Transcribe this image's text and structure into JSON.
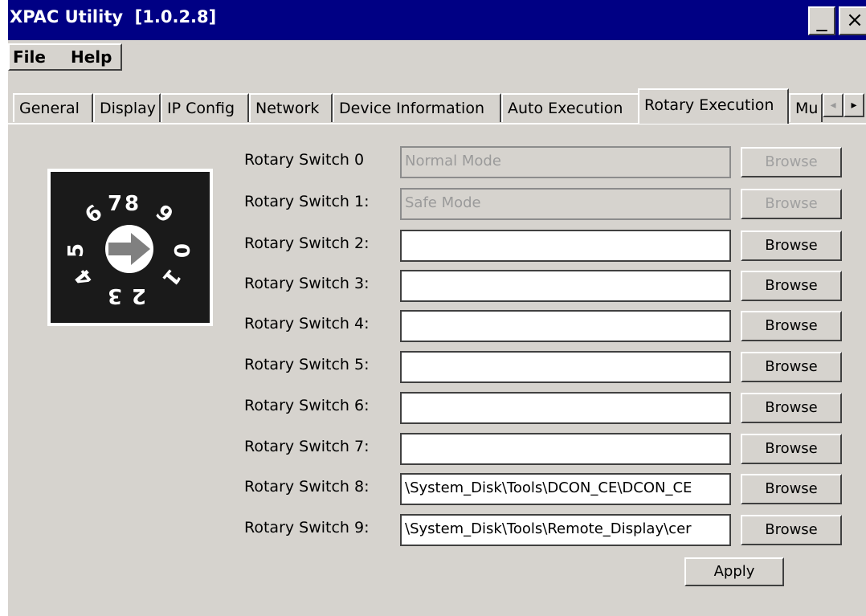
{
  "window": {
    "title": "XPAC Utility  [1.0.2.8]",
    "minimize_glyph": "_",
    "close_glyph": "×"
  },
  "menu": {
    "items": [
      "File",
      "Help"
    ]
  },
  "tabs": {
    "items": [
      "General",
      "Display",
      "IP Config",
      "Network",
      "Device Information",
      "Auto Execution",
      "Rotary Execution",
      "Mu"
    ],
    "active": "Rotary Execution",
    "scroll_left": "◂",
    "scroll_right": "▸"
  },
  "rotary_switch": {
    "icon": "rotary-switch-dial-icon",
    "digits": [
      "0",
      "1",
      "2",
      "3",
      "4",
      "5",
      "6",
      "7",
      "8",
      "9"
    ]
  },
  "rows": [
    {
      "label": "Rotary Switch 0",
      "value": "Normal Mode",
      "enabled": false,
      "button": "Browse"
    },
    {
      "label": "Rotary Switch 1:",
      "value": "Safe Mode",
      "enabled": false,
      "button": "Browse"
    },
    {
      "label": "Rotary Switch 2:",
      "value": "",
      "enabled": true,
      "button": "Browse"
    },
    {
      "label": "Rotary Switch 3:",
      "value": "",
      "enabled": true,
      "button": "Browse"
    },
    {
      "label": "Rotary Switch 4:",
      "value": "",
      "enabled": true,
      "button": "Browse"
    },
    {
      "label": "Rotary Switch 5:",
      "value": "",
      "enabled": true,
      "button": "Browse"
    },
    {
      "label": "Rotary Switch 6:",
      "value": "",
      "enabled": true,
      "button": "Browse"
    },
    {
      "label": "Rotary Switch 7:",
      "value": "",
      "enabled": true,
      "button": "Browse"
    },
    {
      "label": "Rotary Switch 8:",
      "value": "\\System_Disk\\Tools\\DCON_CE\\DCON_CE",
      "enabled": true,
      "button": "Browse"
    },
    {
      "label": "Rotary Switch 9:",
      "value": "\\System_Disk\\Tools\\Remote_Display\\cer",
      "enabled": true,
      "button": "Browse"
    }
  ],
  "apply_label": "Apply",
  "colors": {
    "title_bar": "#000084",
    "face": "#d6d3ce",
    "knob_bg": "#1a1a1a",
    "arrow": "#808080"
  }
}
